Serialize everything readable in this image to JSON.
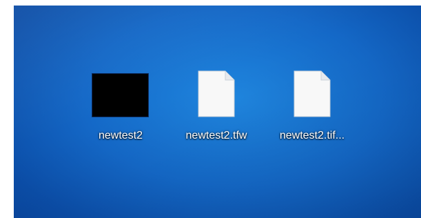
{
  "desktop": {
    "icons": [
      {
        "label": "newtest2",
        "type": "image-thumbnail",
        "icon": "black-image-thumbnail-icon"
      },
      {
        "label": "newtest2.tfw",
        "type": "file",
        "icon": "blank-file-icon"
      },
      {
        "label": "newtest2.tif...",
        "type": "file",
        "icon": "blank-file-icon"
      }
    ],
    "colors": {
      "background_light": "#1f86df",
      "background_dark": "#083f93",
      "label_text": "#ffffff",
      "thumbnail": "#000000",
      "document": "#f8f8f8"
    }
  }
}
